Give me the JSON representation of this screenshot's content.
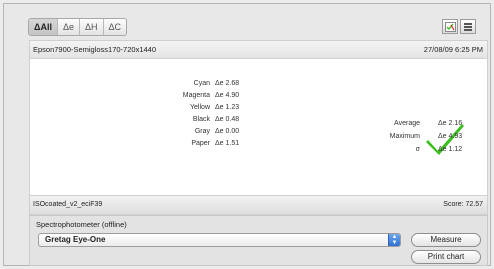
{
  "tabs": [
    "ΔAll",
    "Δe",
    "ΔH",
    "ΔC"
  ],
  "header": {
    "left": "Epson7900-Semigloss170-720x1440",
    "right": "27/08/09 6:25 PM"
  },
  "colors": [
    {
      "name": "Cyan",
      "value": "Δe 2.68"
    },
    {
      "name": "Magenta",
      "value": "Δe 4.90"
    },
    {
      "name": "Yellow",
      "value": "Δe 1.23"
    },
    {
      "name": "Black",
      "value": "Δe 0.48"
    },
    {
      "name": "Gray",
      "value": "Δe 0.00"
    },
    {
      "name": "Paper",
      "value": "Δe 1.51"
    }
  ],
  "stats": [
    {
      "label": "Average",
      "value": "Δe 2.16"
    },
    {
      "label": "Maximum",
      "value": "Δe 4.93"
    },
    {
      "label": "σ",
      "value": "Δe 1.12"
    }
  ],
  "footer": {
    "left": "ISOcoated_v2_eciF39",
    "right": "Score: 72.57"
  },
  "instrument": {
    "group_label": "Spectrophotometer (offline)",
    "selected": "Gretag Eye-One"
  },
  "buttons": {
    "measure": "Measure",
    "print": "Print chart"
  },
  "accent": {
    "check": "#3bbf1f",
    "select": "#2e72d6"
  }
}
